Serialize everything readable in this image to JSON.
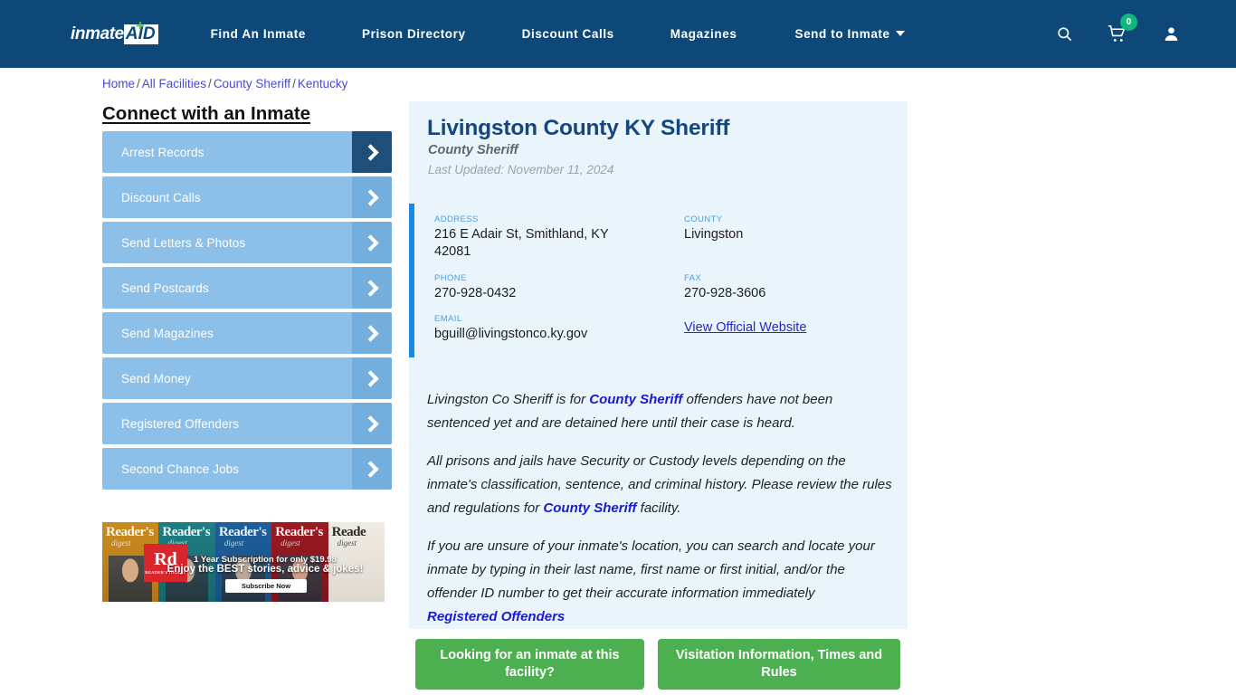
{
  "header": {
    "logo": {
      "word": "inmate",
      "aid": "AID",
      "plus": "+"
    },
    "nav": [
      {
        "label": "Find An Inmate"
      },
      {
        "label": "Prison Directory"
      },
      {
        "label": "Discount Calls"
      },
      {
        "label": "Magazines"
      },
      {
        "label": "Send to Inmate"
      }
    ],
    "icons": {
      "search": "search-icon",
      "cart": "cart-icon",
      "account": "account-icon"
    },
    "cart_count": "0",
    "brand_color": "#0e4878",
    "badge_color": "#0fb67e"
  },
  "breadcrumb": {
    "items": [
      "Home",
      "All Facilities",
      "County Sheriff",
      "Kentucky"
    ],
    "separator": "/"
  },
  "sidebar": {
    "title": "Connect with an Inmate",
    "items": [
      {
        "label": "Arrest Records",
        "active": true
      },
      {
        "label": "Discount Calls",
        "active": false
      },
      {
        "label": "Send Letters & Photos",
        "active": false
      },
      {
        "label": "Send Postcards",
        "active": false
      },
      {
        "label": "Send Magazines",
        "active": false
      },
      {
        "label": "Send Money",
        "active": false
      },
      {
        "label": "Registered Offenders",
        "active": false
      },
      {
        "label": "Second Chance Jobs",
        "active": false
      }
    ],
    "button_color": "#8cc0e8",
    "arrow_color": "#74aedd",
    "arrow_active_color": "#1f4e79"
  },
  "ad": {
    "brand": "Reader's",
    "brand_sub": "digest",
    "logo_text": "Rd",
    "logo_sub": "READER'S DIGEST",
    "line1": "1 Year Subscription for only $19.98",
    "line2": "Enjoy the BEST stories, advice & jokes!",
    "cta": "Subscribe Now",
    "covers": [
      "Reader's",
      "Reader's",
      "Reader's",
      "Reader's",
      "Reade"
    ]
  },
  "facility": {
    "title": "Livingston County KY Sheriff",
    "subtitle": "County Sheriff",
    "last_updated": "Last Updated: November 11, 2024",
    "fields": [
      {
        "label": "ADDRESS",
        "value": "216 E Adair St, Smithland, KY 42081"
      },
      {
        "label": "COUNTY",
        "value": "Livingston"
      },
      {
        "label": "PHONE",
        "value": "270-928-0432"
      },
      {
        "label": "FAX",
        "value": "270-928-3606"
      },
      {
        "label": "EMAIL",
        "value": "bguill@livingstonco.ky.gov"
      }
    ],
    "website_link": "View Official Website",
    "accent_color": "#1b8ae0",
    "card_bg": "#e9f4fb"
  },
  "body": {
    "p1_a": "Livingston Co Sheriff is for ",
    "p1_link": "County Sheriff",
    "p1_b": " offenders have not been sentenced yet and are detained here until their case is heard.",
    "p2_a": "All prisons and jails have Security or Custody levels depending on the inmate's classification, sentence, and criminal history. Please review the rules and regulations for ",
    "p2_link": "County Sheriff",
    "p2_b": " facility.",
    "p3_a": "If you are unsure of your inmate's location, you can search and locate your inmate by typing in their last name, first name or first initial, and/or the offender ID number to get their accurate information immediately ",
    "p3_link": "Registered Offenders"
  },
  "cta": {
    "button1": "Looking for an inmate at this facility?",
    "button2": "Visitation Information, Times and Rules",
    "color": "#4caf50"
  }
}
